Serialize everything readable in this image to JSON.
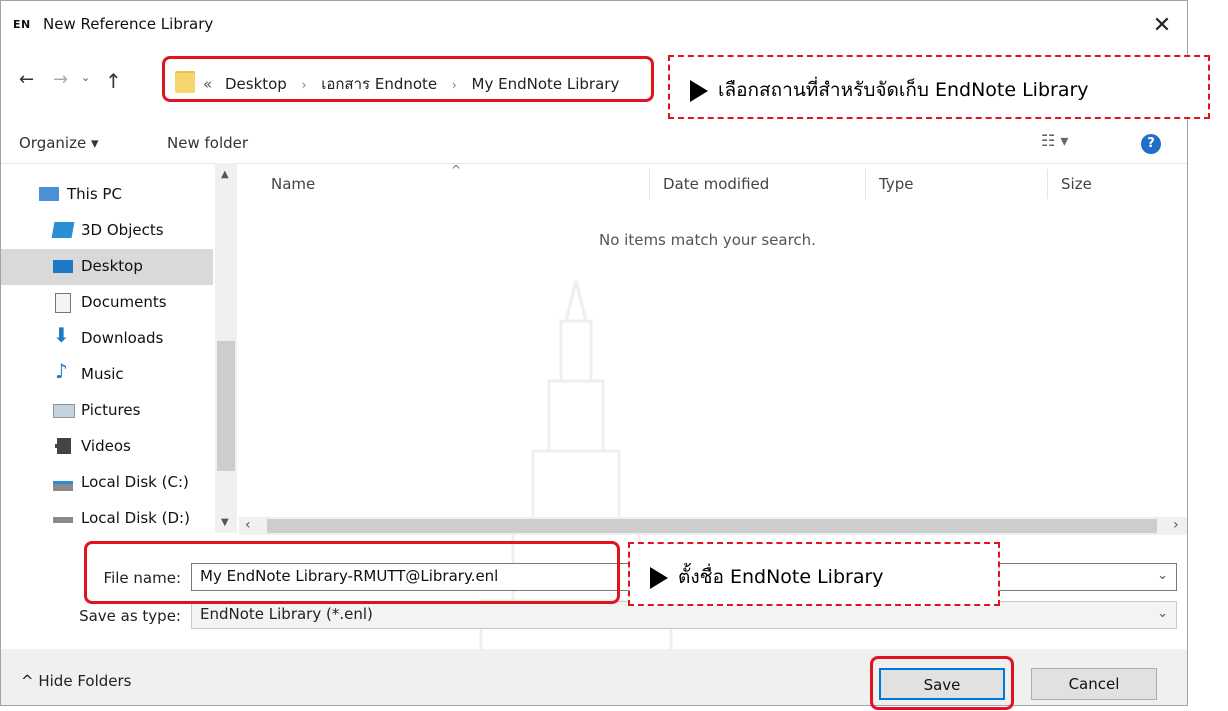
{
  "window": {
    "app_badge": "EN",
    "title": "New Reference Library",
    "close_glyph": "✕"
  },
  "nav": {
    "back_glyph": "←",
    "forward_glyph": "→",
    "recent_glyph": "⌄",
    "up_glyph": "↑",
    "crumb_overflow": "«",
    "breadcrumbs": [
      "Desktop",
      "เอกสาร Endnote",
      "My EndNote Library"
    ],
    "separator": "›"
  },
  "toolbar": {
    "organize_label": "Organize ▾",
    "new_folder_label": "New folder",
    "view_glyph": "☷ ▾",
    "help_glyph": "?"
  },
  "sidebar": {
    "items": [
      {
        "label": "This PC",
        "icon": "computer-icon"
      },
      {
        "label": "3D Objects",
        "icon": "cube-icon"
      },
      {
        "label": "Desktop",
        "icon": "desktop-icon",
        "selected": true
      },
      {
        "label": "Documents",
        "icon": "document-icon"
      },
      {
        "label": "Downloads",
        "icon": "download-icon"
      },
      {
        "label": "Music",
        "icon": "music-icon"
      },
      {
        "label": "Pictures",
        "icon": "pictures-icon"
      },
      {
        "label": "Videos",
        "icon": "video-icon"
      },
      {
        "label": "Local Disk (C:)",
        "icon": "disk-c-icon"
      },
      {
        "label": "Local Disk (D:)",
        "icon": "disk-d-icon"
      }
    ]
  },
  "filelist": {
    "columns": [
      "Name",
      "Date modified",
      "Type",
      "Size"
    ],
    "empty_message": "No items match your search."
  },
  "form": {
    "file_name_label": "File name:",
    "file_name_value": "My EndNote Library-RMUTT@Library.enl",
    "save_as_type_label": "Save as type:",
    "save_as_type_value": "EndNote Library (*.enl)"
  },
  "footer": {
    "hide_folders_label": "Hide Folders",
    "save_label": "Save",
    "cancel_label": "Cancel"
  },
  "annotations": {
    "location_note": "เลือกสถานที่สำหรับจัดเก็บ EndNote Library",
    "name_note": "ตั้งชื่อ  EndNote Library"
  },
  "colors": {
    "highlight_red": "#e0141e",
    "selected_bg": "#d9d9d9",
    "accent_blue": "#0078d7"
  }
}
